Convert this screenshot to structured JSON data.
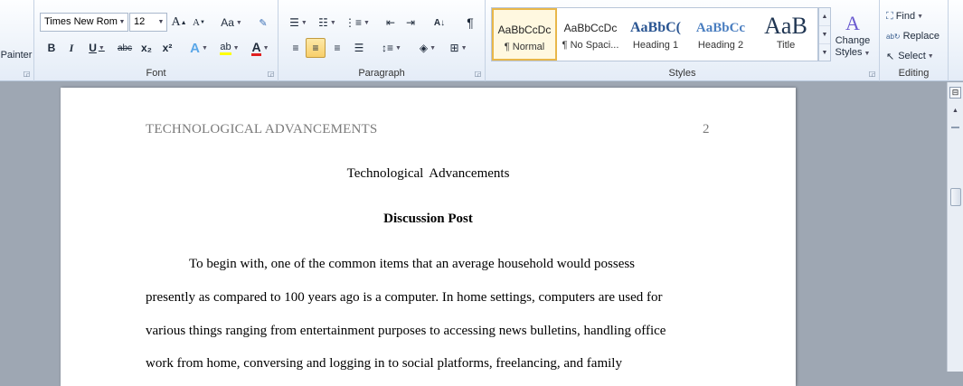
{
  "clipboard": {
    "format_painter_label": "Painter"
  },
  "font": {
    "family": "Times New Rom",
    "size": "12",
    "group_label": "Font",
    "grow_label": "A",
    "shrink_label": "A",
    "case_label": "Aa",
    "bold_label": "B",
    "italic_label": "I",
    "underline_label": "U",
    "strike_label": "abc",
    "sub_label": "x₂",
    "super_label": "x²",
    "effects_label": "A",
    "highlight_label": "ab",
    "color_label": "A",
    "color": "#e02020"
  },
  "paragraph": {
    "group_label": "Paragraph",
    "pilcrow": "¶"
  },
  "styles": {
    "group_label": "Styles",
    "items": [
      {
        "sample": "AaBbCcDc",
        "name": "¶ Normal"
      },
      {
        "sample": "AaBbCcDc",
        "name": "¶ No Spaci..."
      },
      {
        "sample": "AaBbC(",
        "name": "Heading 1"
      },
      {
        "sample": "AaBbCc",
        "name": "Heading 2"
      },
      {
        "sample": "AaB",
        "name": "Title"
      }
    ],
    "change_styles_line1": "Change",
    "change_styles_line2": "Styles"
  },
  "editing": {
    "group_label": "Editing",
    "find_label": "Find",
    "replace_label": "Replace",
    "select_label": "Select"
  },
  "document": {
    "header_title": "TECHNOLOGICAL ADVANCEMENTS",
    "page_number": "2",
    "title": "Technological Advancements",
    "heading": "Discussion Post",
    "lines": [
      "To begin with, one of the common items that an average household would possess",
      "presently as compared to 100 years ago is a computer. In home settings, computers are used for",
      "various things ranging from entertainment purposes to accessing news bulletins, handling office",
      "work from home, conversing and logging in to social platforms, freelancing, and family"
    ]
  },
  "colors": {
    "accent_selected": "#f8cf6a",
    "ribbon_bg": "#e4ecf7",
    "page_bg": "#9ea7b3"
  }
}
